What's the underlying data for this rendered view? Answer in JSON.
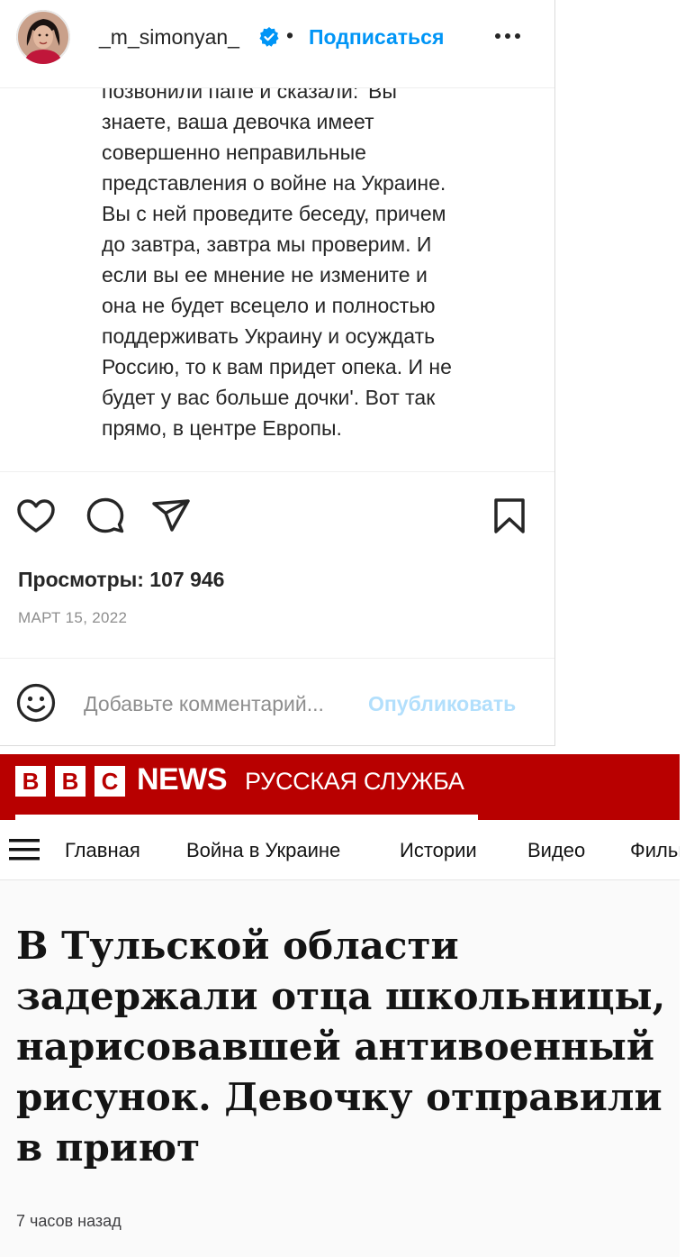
{
  "instagram": {
    "username": "_m_simonyan_",
    "separator_dot": "•",
    "subscribe_label": "Подписаться",
    "caption_lines": [
      "позвонили папе и сказали: 'Вы",
      "знаете, ваша девочка имеет",
      "совершенно неправильные",
      "представления о войне на Украине.",
      "Вы с ней проведите беседу, причем",
      "до завтра, завтра мы проверим. И",
      "если вы ее мнение не измените и",
      "она не будет всецело и полностью",
      "поддерживать Украину и осуждать",
      "Россию, то к вам придет опека. И не",
      "будет у вас больше дочки'. Вот так",
      "прямо, в центре Европы."
    ],
    "views_label": "Просмотры: 107 946",
    "date": "МАРТ 15, 2022",
    "comment_placeholder": "Добавьте комментарий...",
    "publish_label": "Опубликовать",
    "colors": {
      "link_blue": "#0095f6",
      "publish_disabled": "#b2dffc",
      "text": "#262626",
      "muted": "#8e8e8e"
    }
  },
  "bbc": {
    "logo_letters": [
      "B",
      "B",
      "C"
    ],
    "news_label": "NEWS",
    "service_label": "РУССКАЯ СЛУЖБА",
    "nav": [
      "Главная",
      "Война в Украине",
      "Истории",
      "Видео",
      "Фильмы"
    ],
    "headline_lines": [
      "В Тульской области",
      "задержали отца школьницы,",
      "нарисовавшей антивоенный",
      "рисунок. Девочку отправили",
      "в приют"
    ],
    "time_ago": "7 часов назад",
    "colors": {
      "brand_red": "#b80000"
    }
  },
  "icons": [
    "heart-icon",
    "comment-icon",
    "share-icon",
    "bookmark-icon",
    "emoji-icon",
    "more-icon",
    "verified-icon",
    "menu-icon"
  ]
}
